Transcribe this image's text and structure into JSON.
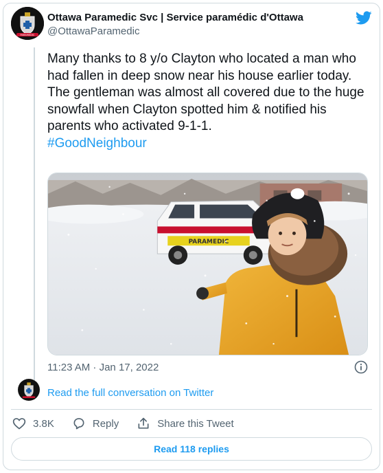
{
  "author": {
    "name": "Ottawa Paramedic Svc | Service paramédic d'Ottawa",
    "handle": "@OttawaParamedic",
    "avatar_badge_text": "PARAMEDIC"
  },
  "tweet": {
    "line1": "Many thanks to 8 y/o Clayton who located a man who had fallen in deep snow near his house earlier today.",
    "line2": "The gentleman was almost all covered due to the huge snowfall when Clayton spotted him & notified his parents who activated 9-1-1.",
    "hashtag": "#GoodNeighbour"
  },
  "media": {
    "vehicle_marking": "PARAMEDIC"
  },
  "timestamp": "11:23 AM · Jan 17, 2022",
  "read_conversation": "Read the full conversation on Twitter",
  "actions": {
    "likes": "3.8K",
    "reply": "Reply",
    "share": "Share this Tweet"
  },
  "read_replies": "Read 118 replies",
  "colors": {
    "accent": "#1d9bf0",
    "text": "#0f1419",
    "muted": "#536471",
    "border": "#cfd9de"
  },
  "icons": [
    "twitter-bird-icon",
    "info-icon",
    "heart-icon",
    "reply-bubble-icon",
    "share-icon"
  ]
}
